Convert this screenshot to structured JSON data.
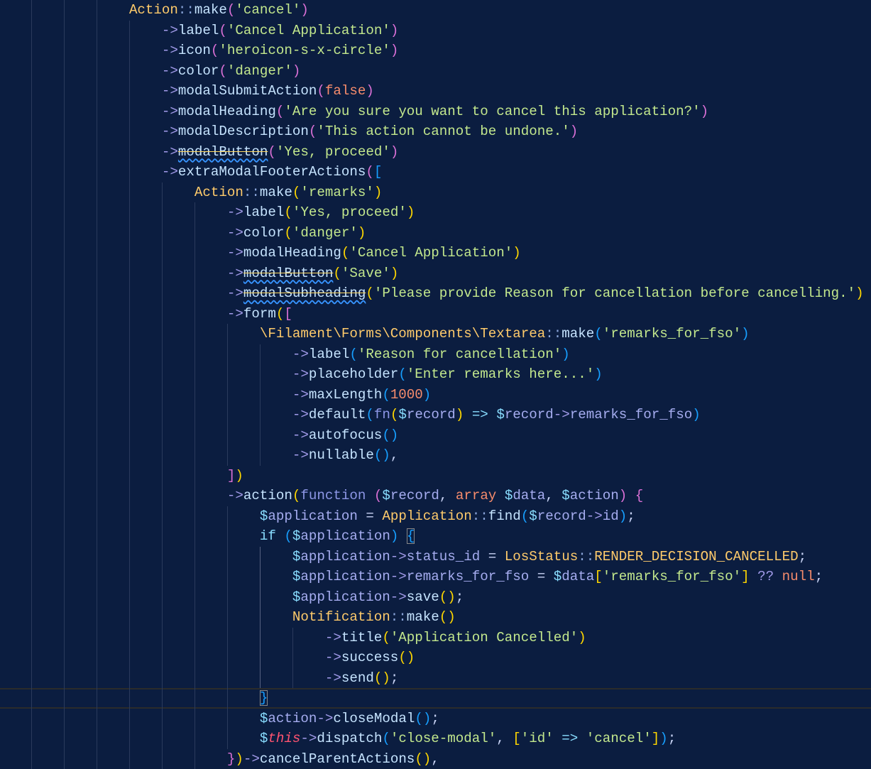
{
  "code": {
    "lines": [
      {
        "indent": 16,
        "tokens": [
          [
            "c",
            "Action"
          ],
          [
            "dc",
            "::"
          ],
          [
            "m",
            "make"
          ],
          [
            "p",
            "("
          ],
          [
            "s",
            "'cancel'"
          ],
          [
            "p",
            ")"
          ]
        ]
      },
      {
        "indent": 20,
        "tokens": [
          [
            "a",
            "->"
          ],
          [
            "m",
            "label"
          ],
          [
            "p",
            "("
          ],
          [
            "s",
            "'Cancel Application'"
          ],
          [
            "p",
            ")"
          ]
        ]
      },
      {
        "indent": 20,
        "tokens": [
          [
            "a",
            "->"
          ],
          [
            "m",
            "icon"
          ],
          [
            "p",
            "("
          ],
          [
            "s",
            "'heroicon-s-x-circle'"
          ],
          [
            "p",
            ")"
          ]
        ]
      },
      {
        "indent": 20,
        "tokens": [
          [
            "a",
            "->"
          ],
          [
            "m",
            "color"
          ],
          [
            "p",
            "("
          ],
          [
            "s",
            "'danger'"
          ],
          [
            "p",
            ")"
          ]
        ]
      },
      {
        "indent": 20,
        "tokens": [
          [
            "a",
            "->"
          ],
          [
            "m",
            "modalSubmitAction"
          ],
          [
            "p",
            "("
          ],
          [
            "k",
            "false"
          ],
          [
            "p",
            ")"
          ]
        ]
      },
      {
        "indent": 20,
        "tokens": [
          [
            "a",
            "->"
          ],
          [
            "m",
            "modalHeading"
          ],
          [
            "p",
            "("
          ],
          [
            "s",
            "'Are you sure you want to cancel this application?'"
          ],
          [
            "p",
            ")"
          ]
        ]
      },
      {
        "indent": 20,
        "tokens": [
          [
            "a",
            "->"
          ],
          [
            "m",
            "modalDescription"
          ],
          [
            "p",
            "("
          ],
          [
            "s",
            "'This action cannot be undone.'"
          ],
          [
            "p",
            ")"
          ]
        ]
      },
      {
        "indent": 20,
        "tokens": [
          [
            "a",
            "->"
          ],
          [
            "dep",
            "modalButton"
          ],
          [
            "p",
            "("
          ],
          [
            "s",
            "'Yes, proceed'"
          ],
          [
            "p",
            ")"
          ]
        ]
      },
      {
        "indent": 20,
        "tokens": [
          [
            "a",
            "->"
          ],
          [
            "m",
            "extraModalFooterActions"
          ],
          [
            "p",
            "("
          ],
          [
            "b",
            "["
          ]
        ]
      },
      {
        "indent": 24,
        "tokens": [
          [
            "c",
            "Action"
          ],
          [
            "dc",
            "::"
          ],
          [
            "m",
            "make"
          ],
          [
            "y",
            "("
          ],
          [
            "s",
            "'remarks'"
          ],
          [
            "y",
            ")"
          ]
        ]
      },
      {
        "indent": 28,
        "tokens": [
          [
            "a",
            "->"
          ],
          [
            "m",
            "label"
          ],
          [
            "y",
            "("
          ],
          [
            "s",
            "'Yes, proceed'"
          ],
          [
            "y",
            ")"
          ]
        ]
      },
      {
        "indent": 28,
        "tokens": [
          [
            "a",
            "->"
          ],
          [
            "m",
            "color"
          ],
          [
            "y",
            "("
          ],
          [
            "s",
            "'danger'"
          ],
          [
            "y",
            ")"
          ]
        ]
      },
      {
        "indent": 28,
        "tokens": [
          [
            "a",
            "->"
          ],
          [
            "m",
            "modalHeading"
          ],
          [
            "y",
            "("
          ],
          [
            "s",
            "'Cancel Application'"
          ],
          [
            "y",
            ")"
          ]
        ]
      },
      {
        "indent": 28,
        "tokens": [
          [
            "a",
            "->"
          ],
          [
            "dep",
            "modalButton"
          ],
          [
            "y",
            "("
          ],
          [
            "s",
            "'Save'"
          ],
          [
            "y",
            ")"
          ]
        ]
      },
      {
        "indent": 28,
        "tokens": [
          [
            "a",
            "->"
          ],
          [
            "dep",
            "modalSubheading"
          ],
          [
            "y",
            "("
          ],
          [
            "s",
            "'Please provide Reason for cancellation before cancelling.'"
          ],
          [
            "y",
            ")"
          ]
        ]
      },
      {
        "indent": 28,
        "tokens": [
          [
            "a",
            "->"
          ],
          [
            "m",
            "form"
          ],
          [
            "y",
            "("
          ],
          [
            "p",
            "["
          ]
        ]
      },
      {
        "indent": 32,
        "tokens": [
          [
            "c",
            "\\Filament\\Forms\\Components\\Textarea"
          ],
          [
            "dc",
            "::"
          ],
          [
            "m",
            "make"
          ],
          [
            "b",
            "("
          ],
          [
            "s",
            "'remarks_for_fso'"
          ],
          [
            "b",
            ")"
          ]
        ]
      },
      {
        "indent": 36,
        "tokens": [
          [
            "a",
            "->"
          ],
          [
            "m",
            "label"
          ],
          [
            "b",
            "("
          ],
          [
            "s",
            "'Reason for cancellation'"
          ],
          [
            "b",
            ")"
          ]
        ]
      },
      {
        "indent": 36,
        "tokens": [
          [
            "a",
            "->"
          ],
          [
            "m",
            "placeholder"
          ],
          [
            "b",
            "("
          ],
          [
            "s",
            "'Enter remarks here...'"
          ],
          [
            "b",
            ")"
          ]
        ]
      },
      {
        "indent": 36,
        "tokens": [
          [
            "a",
            "->"
          ],
          [
            "m",
            "maxLength"
          ],
          [
            "b",
            "("
          ],
          [
            "k",
            "1000"
          ],
          [
            "b",
            ")"
          ]
        ]
      },
      {
        "indent": 36,
        "tokens": [
          [
            "a",
            "->"
          ],
          [
            "m",
            "default"
          ],
          [
            "b",
            "("
          ],
          [
            "f",
            "fn"
          ],
          [
            "y",
            "("
          ],
          [
            "d",
            "$"
          ],
          [
            "v",
            "record"
          ],
          [
            "y",
            ")"
          ],
          [
            "o",
            " "
          ],
          [
            "i",
            "=>"
          ],
          [
            "o",
            " "
          ],
          [
            "d",
            "$"
          ],
          [
            "v",
            "record"
          ],
          [
            "a",
            "->"
          ],
          [
            "pr",
            "remarks_for_fso"
          ],
          [
            "b",
            ")"
          ]
        ]
      },
      {
        "indent": 36,
        "tokens": [
          [
            "a",
            "->"
          ],
          [
            "m",
            "autofocus"
          ],
          [
            "b",
            "()"
          ]
        ]
      },
      {
        "indent": 36,
        "tokens": [
          [
            "a",
            "->"
          ],
          [
            "m",
            "nullable"
          ],
          [
            "b",
            "()"
          ],
          [
            "o",
            ","
          ]
        ]
      },
      {
        "indent": 28,
        "tokens": [
          [
            "p",
            "]"
          ],
          [
            "y",
            ")"
          ]
        ]
      },
      {
        "indent": 28,
        "tokens": [
          [
            "a",
            "->"
          ],
          [
            "m",
            "action"
          ],
          [
            "y",
            "("
          ],
          [
            "f",
            "function "
          ],
          [
            "p",
            "("
          ],
          [
            "d",
            "$"
          ],
          [
            "v",
            "record"
          ],
          [
            "o",
            ", "
          ],
          [
            "k",
            "array "
          ],
          [
            "d",
            "$"
          ],
          [
            "v",
            "data"
          ],
          [
            "o",
            ", "
          ],
          [
            "d",
            "$"
          ],
          [
            "v",
            "action"
          ],
          [
            "p",
            ")"
          ],
          [
            "o",
            " "
          ],
          [
            "p",
            "{"
          ]
        ]
      },
      {
        "indent": 32,
        "tokens": [
          [
            "d",
            "$"
          ],
          [
            "v",
            "application"
          ],
          [
            "o",
            " = "
          ],
          [
            "c",
            "Application"
          ],
          [
            "dc",
            "::"
          ],
          [
            "m",
            "find"
          ],
          [
            "b",
            "("
          ],
          [
            "d",
            "$"
          ],
          [
            "v",
            "record"
          ],
          [
            "a",
            "->"
          ],
          [
            "pr",
            "id"
          ],
          [
            "b",
            ")"
          ],
          [
            "o",
            ";"
          ]
        ]
      },
      {
        "indent": 32,
        "tokens": [
          [
            "i",
            "if "
          ],
          [
            "b",
            "("
          ],
          [
            "d",
            "$"
          ],
          [
            "v",
            "application"
          ],
          [
            "b",
            ")"
          ],
          [
            "o",
            " "
          ],
          [
            "b box",
            "{"
          ]
        ]
      },
      {
        "indent": 36,
        "tokens": [
          [
            "d",
            "$"
          ],
          [
            "v",
            "application"
          ],
          [
            "a",
            "->"
          ],
          [
            "pr",
            "status_id"
          ],
          [
            "o",
            " = "
          ],
          [
            "c",
            "LosStatus"
          ],
          [
            "dc",
            "::"
          ],
          [
            "c",
            "RENDER_DECISION_CANCELLED"
          ],
          [
            "o",
            ";"
          ]
        ]
      },
      {
        "indent": 36,
        "tokens": [
          [
            "d",
            "$"
          ],
          [
            "v",
            "application"
          ],
          [
            "a",
            "->"
          ],
          [
            "pr",
            "remarks_for_fso"
          ],
          [
            "o",
            " = "
          ],
          [
            "d",
            "$"
          ],
          [
            "v",
            "data"
          ],
          [
            "y",
            "["
          ],
          [
            "s",
            "'remarks_for_fso'"
          ],
          [
            "y",
            "]"
          ],
          [
            "o",
            " "
          ],
          [
            "a",
            "??"
          ],
          [
            "o",
            " "
          ],
          [
            "k",
            "null"
          ],
          [
            "o",
            ";"
          ]
        ]
      },
      {
        "indent": 36,
        "tokens": [
          [
            "d",
            "$"
          ],
          [
            "v",
            "application"
          ],
          [
            "a",
            "->"
          ],
          [
            "m",
            "save"
          ],
          [
            "y",
            "()"
          ],
          [
            "o",
            ";"
          ]
        ]
      },
      {
        "indent": 36,
        "tokens": [
          [
            "c",
            "Notification"
          ],
          [
            "dc",
            "::"
          ],
          [
            "m",
            "make"
          ],
          [
            "y",
            "()"
          ]
        ]
      },
      {
        "indent": 40,
        "tokens": [
          [
            "a",
            "->"
          ],
          [
            "m",
            "title"
          ],
          [
            "y",
            "("
          ],
          [
            "s",
            "'Application Cancelled'"
          ],
          [
            "y",
            ")"
          ]
        ]
      },
      {
        "indent": 40,
        "tokens": [
          [
            "a",
            "->"
          ],
          [
            "m",
            "success"
          ],
          [
            "y",
            "()"
          ]
        ]
      },
      {
        "indent": 40,
        "tokens": [
          [
            "a",
            "->"
          ],
          [
            "m",
            "send"
          ],
          [
            "y",
            "()"
          ],
          [
            "o",
            ";"
          ]
        ]
      },
      {
        "indent": 32,
        "current": true,
        "tokens": [
          [
            "b box",
            "}"
          ]
        ]
      },
      {
        "indent": 32,
        "tokens": [
          [
            "d",
            "$"
          ],
          [
            "v",
            "action"
          ],
          [
            "a",
            "->"
          ],
          [
            "m",
            "closeModal"
          ],
          [
            "b",
            "()"
          ],
          [
            "o",
            ";"
          ]
        ]
      },
      {
        "indent": 32,
        "tokens": [
          [
            "d",
            "$"
          ],
          [
            "t",
            "this"
          ],
          [
            "a",
            "->"
          ],
          [
            "m",
            "dispatch"
          ],
          [
            "b",
            "("
          ],
          [
            "s",
            "'close-modal'"
          ],
          [
            "o",
            ", "
          ],
          [
            "y",
            "["
          ],
          [
            "s",
            "'id'"
          ],
          [
            "o",
            " "
          ],
          [
            "i",
            "=>"
          ],
          [
            "o",
            " "
          ],
          [
            "s",
            "'cancel'"
          ],
          [
            "y",
            "]"
          ],
          [
            "b",
            ")"
          ],
          [
            "o",
            ";"
          ]
        ]
      },
      {
        "indent": 28,
        "tokens": [
          [
            "p",
            "}"
          ],
          [
            "y",
            ")"
          ],
          [
            "a",
            "->"
          ],
          [
            "m",
            "cancelParentActions"
          ],
          [
            "y",
            "()"
          ],
          [
            "o",
            ","
          ]
        ]
      }
    ]
  }
}
